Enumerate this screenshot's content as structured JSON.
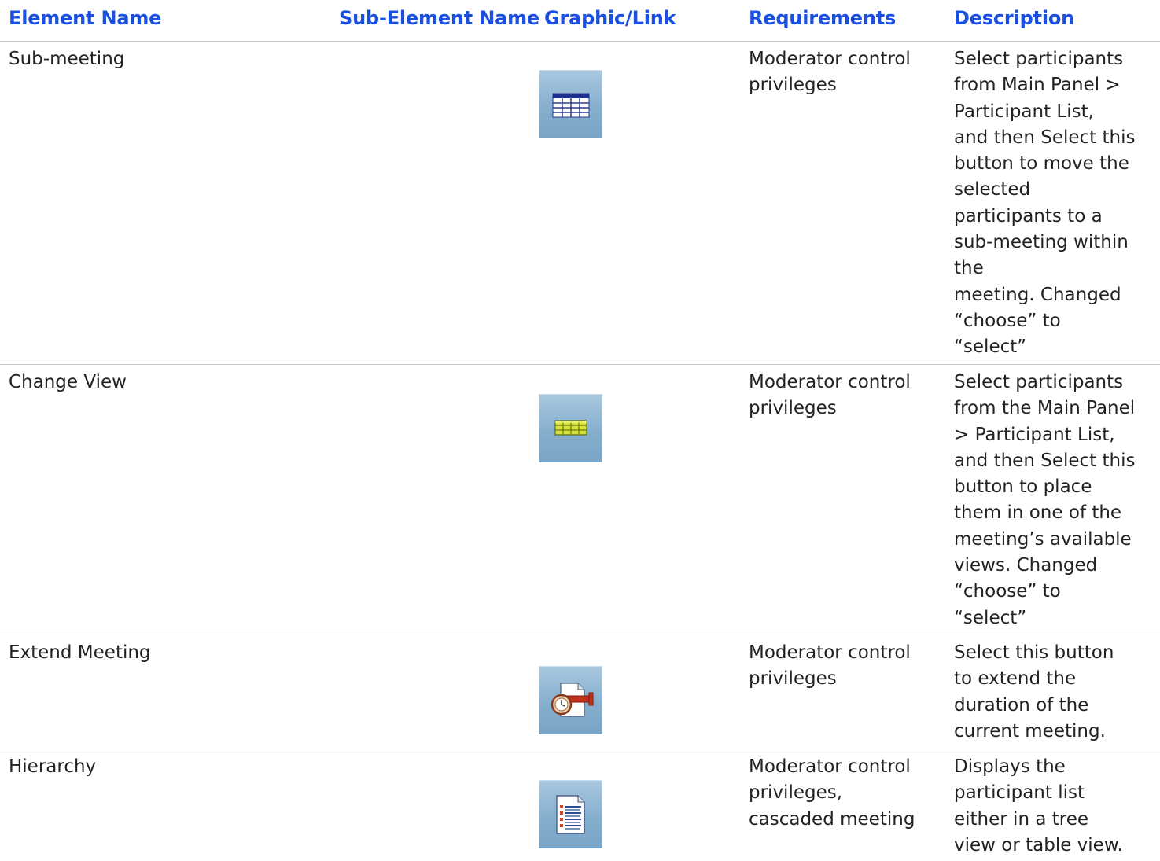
{
  "table": {
    "headers": {
      "element_name": "Element Name",
      "sub_element_name": "Sub-Element Name",
      "graphic_link": "Graphic/Link",
      "requirements": "Requirements",
      "description": "Description"
    },
    "rows": [
      {
        "element_name": "Sub-meeting",
        "icon": "sub-meeting-grid-icon",
        "requirements": [
          "Moderator control",
          "privileges"
        ],
        "description": [
          "Select participants",
          "from Main Panel >",
          "Participant List,",
          "and then Select this",
          "button to move the",
          "selected",
          "participants to a",
          "sub-meeting within",
          "the",
          "meeting. Changed",
          "“choose” to",
          "“select”"
        ]
      },
      {
        "element_name": "Change View",
        "icon": "change-view-grid-icon",
        "requirements": [
          "Moderator control",
          "privileges"
        ],
        "description": [
          "Select participants",
          "from the Main Panel",
          "> Participant List,",
          "and then Select this",
          "button to place",
          "them in one of the",
          "meeting’s available",
          "views. Changed",
          "“choose” to",
          "“select”"
        ]
      },
      {
        "element_name": "Extend Meeting",
        "icon": "extend-meeting-clock-icon",
        "requirements": [
          "Moderator control",
          "privileges"
        ],
        "description": [
          "Select this button",
          "to extend the",
          "duration of the",
          "current meeting."
        ]
      },
      {
        "element_name": "Hierarchy",
        "icon": "hierarchy-list-icon",
        "requirements": [
          "Moderator control",
          "privileges,",
          "cascaded meeting"
        ],
        "description": [
          "Displays the",
          "participant list",
          "either in a tree",
          "view or table view."
        ]
      }
    ]
  }
}
